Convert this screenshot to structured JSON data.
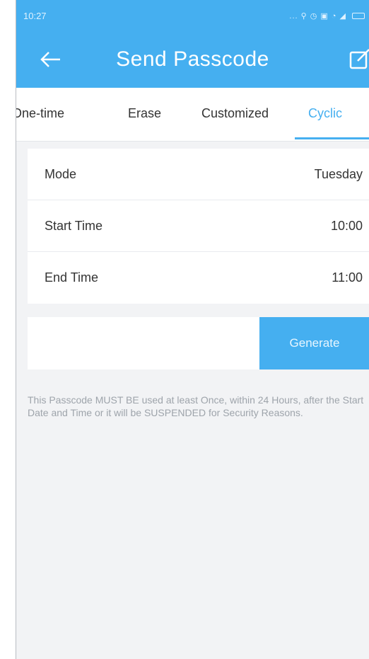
{
  "status_bar": {
    "time": "10:27",
    "icons_text": "... ⚲ ◷ ▣ ◔ ◢"
  },
  "header": {
    "title": "Send Passcode",
    "back_icon": "back-arrow-icon",
    "edit_icon": "edit-icon"
  },
  "tabs": [
    {
      "label": "One-time",
      "active": false
    },
    {
      "label": "Erase",
      "active": false
    },
    {
      "label": "Customized",
      "active": false
    },
    {
      "label": "Cyclic",
      "active": true
    }
  ],
  "form": {
    "rows": [
      {
        "label": "Mode",
        "value": "Tuesday"
      },
      {
        "label": "Start Time",
        "value": "10:00"
      },
      {
        "label": "End Time",
        "value": "11:00"
      }
    ]
  },
  "actions": {
    "generate_label": "Generate"
  },
  "notice": "This Passcode MUST BE used at least Once, within 24 Hours, after the Start Date and Time or it will be SUSPENDED for Security Reasons.",
  "colors": {
    "accent": "#45aff0",
    "background": "#f2f3f5",
    "notice_text": "#9ea4ab"
  }
}
